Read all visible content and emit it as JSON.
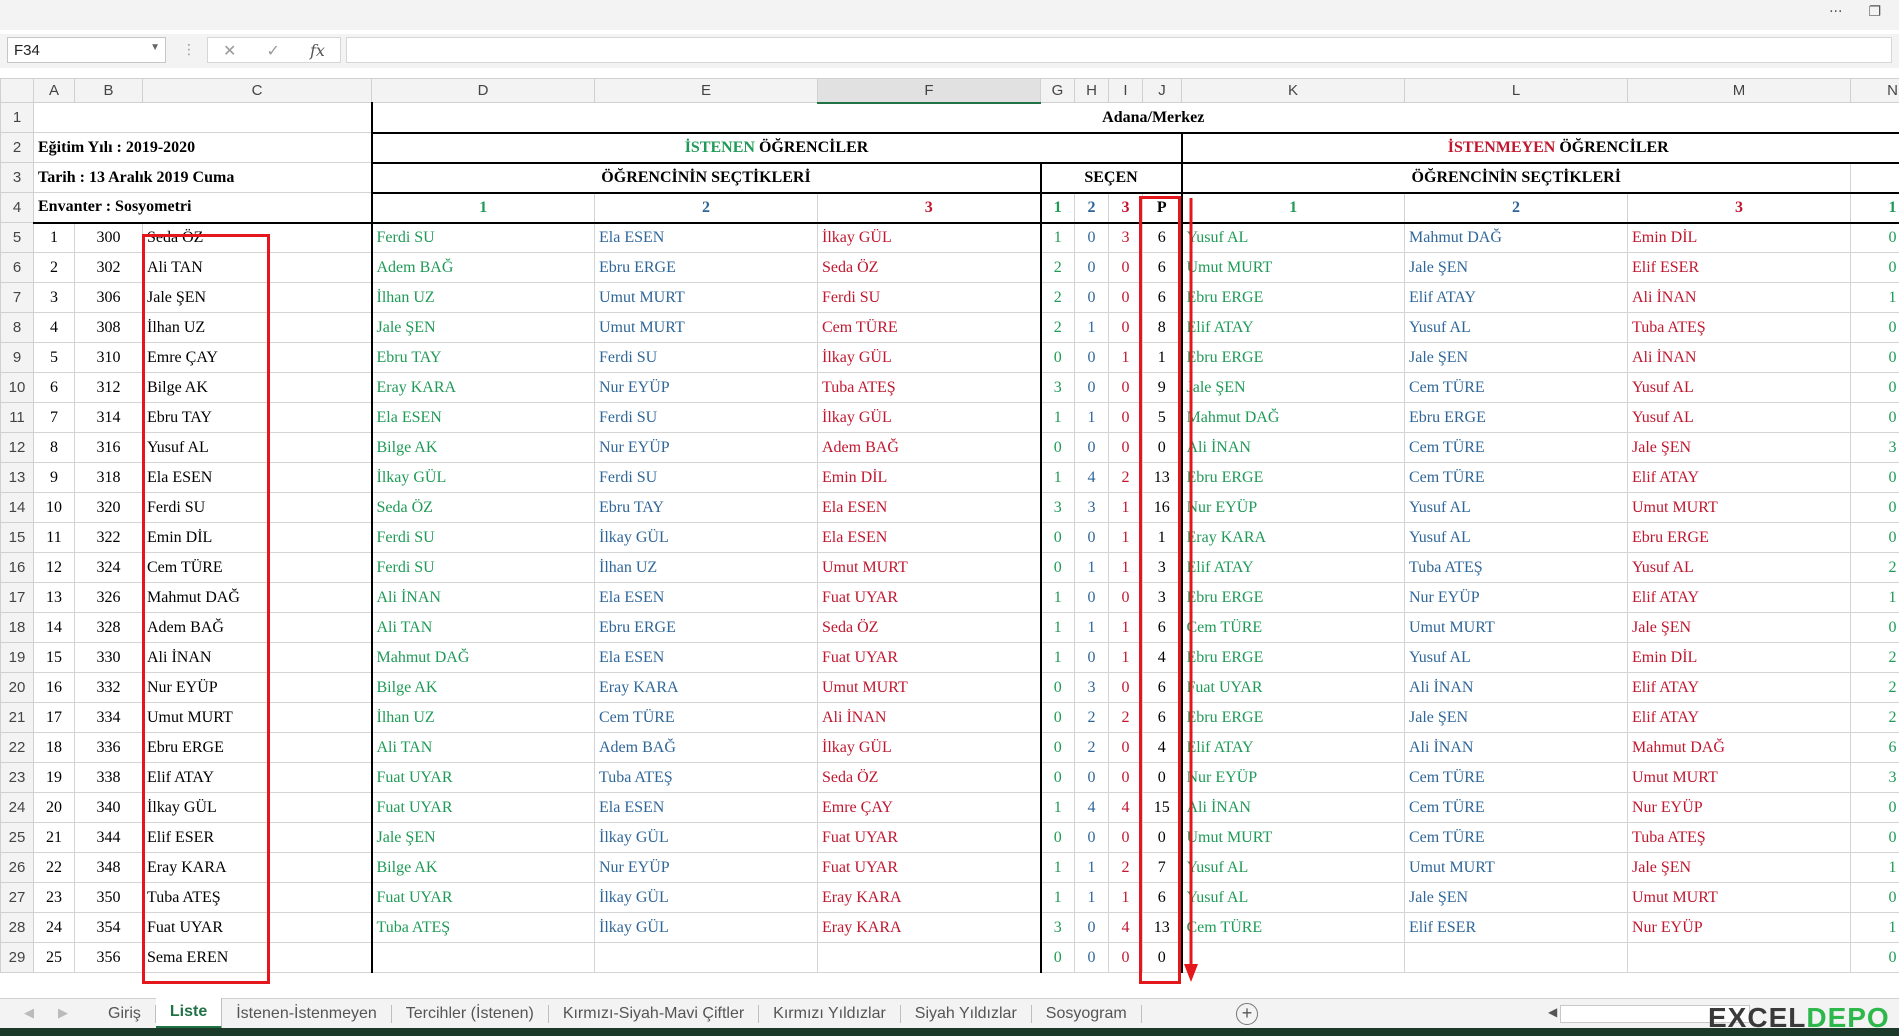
{
  "window": {
    "more_glyph": "···",
    "restore_glyph": "❐"
  },
  "formula_bar": {
    "cell_ref": "F34",
    "cancel": "✕",
    "enter": "✓",
    "fx": "fx",
    "value": ""
  },
  "columns": [
    "A",
    "B",
    "C",
    "D",
    "E",
    "F",
    "G",
    "H",
    "I",
    "J",
    "K",
    "L",
    "M",
    "N"
  ],
  "rows": [
    "1",
    "2",
    "3",
    "4",
    "5",
    "6",
    "7",
    "8",
    "9",
    "10",
    "11",
    "12",
    "13",
    "14",
    "15",
    "16",
    "17",
    "18",
    "19",
    "20",
    "21",
    "22",
    "23",
    "24",
    "25",
    "26",
    "27",
    "28",
    "29"
  ],
  "header": {
    "title": "Adana/Merkez",
    "egitim_yili": "Eğitim Yılı : 2019-2020",
    "tarih": "Tarih : 13 Aralık 2019 Cuma",
    "envanter": "Envanter : Sosyometri",
    "istenen_word": "İSTENEN",
    "istenmeyen_word": "İSTENMEYEN",
    "ogrenciler_word": "ÖĞRENCİLER",
    "ogrencinin_sectikleri": "ÖĞRENCİNİN SEÇTİKLERİ",
    "secen": "SEÇEN",
    "choice_nums": [
      "1",
      "2",
      "3"
    ],
    "p_label": "P",
    "n_partial": "1"
  },
  "students": [
    {
      "no": "1",
      "id": "300",
      "name": "Seda ÖZ",
      "w": [
        "Ferdi SU",
        "Ela ESEN",
        "İlkay GÜL"
      ],
      "s": [
        "1",
        "0",
        "3"
      ],
      "p": "6",
      "u": [
        "Yusuf AL",
        "Mahmut DAĞ",
        "Emin DİL"
      ],
      "n": "0"
    },
    {
      "no": "2",
      "id": "302",
      "name": "Ali TAN",
      "w": [
        "Adem BAĞ",
        "Ebru ERGE",
        "Seda ÖZ"
      ],
      "s": [
        "2",
        "0",
        "0"
      ],
      "p": "6",
      "u": [
        "Umut MURT",
        "Jale ŞEN",
        "Elif ESER"
      ],
      "n": "0"
    },
    {
      "no": "3",
      "id": "306",
      "name": "Jale ŞEN",
      "w": [
        "İlhan UZ",
        "Umut MURT",
        "Ferdi SU"
      ],
      "s": [
        "2",
        "0",
        "0"
      ],
      "p": "6",
      "u": [
        "Ebru ERGE",
        "Elif ATAY",
        "Ali İNAN"
      ],
      "n": "1"
    },
    {
      "no": "4",
      "id": "308",
      "name": "İlhan UZ",
      "w": [
        "Jale ŞEN",
        "Umut MURT",
        "Cem TÜRE"
      ],
      "s": [
        "2",
        "1",
        "0"
      ],
      "p": "8",
      "u": [
        "Elif ATAY",
        "Yusuf AL",
        "Tuba ATEŞ"
      ],
      "n": "0"
    },
    {
      "no": "5",
      "id": "310",
      "name": "Emre ÇAY",
      "w": [
        "Ebru TAY",
        "Ferdi SU",
        "İlkay GÜL"
      ],
      "s": [
        "0",
        "0",
        "1"
      ],
      "p": "1",
      "u": [
        "Ebru ERGE",
        "Jale ŞEN",
        "Ali İNAN"
      ],
      "n": "0"
    },
    {
      "no": "6",
      "id": "312",
      "name": "Bilge AK",
      "w": [
        "Eray KARA",
        "Nur EYÜP",
        "Tuba ATEŞ"
      ],
      "s": [
        "3",
        "0",
        "0"
      ],
      "p": "9",
      "u": [
        "Jale ŞEN",
        "Cem TÜRE",
        "Yusuf AL"
      ],
      "n": "0"
    },
    {
      "no": "7",
      "id": "314",
      "name": "Ebru TAY",
      "w": [
        "Ela ESEN",
        "Ferdi SU",
        "İlkay GÜL"
      ],
      "s": [
        "1",
        "1",
        "0"
      ],
      "p": "5",
      "u": [
        "Mahmut DAĞ",
        "Ebru ERGE",
        "Yusuf AL"
      ],
      "n": "0"
    },
    {
      "no": "8",
      "id": "316",
      "name": "Yusuf AL",
      "w": [
        "Bilge AK",
        "Nur EYÜP",
        "Adem BAĞ"
      ],
      "s": [
        "0",
        "0",
        "0"
      ],
      "p": "0",
      "u": [
        "Ali İNAN",
        "Cem TÜRE",
        "Jale ŞEN"
      ],
      "n": "3"
    },
    {
      "no": "9",
      "id": "318",
      "name": "Ela ESEN",
      "w": [
        "İlkay GÜL",
        "Ferdi SU",
        "Emin DİL"
      ],
      "s": [
        "1",
        "4",
        "2"
      ],
      "p": "13",
      "u": [
        "Ebru ERGE",
        "Cem TÜRE",
        "Elif ATAY"
      ],
      "n": "0"
    },
    {
      "no": "10",
      "id": "320",
      "name": "Ferdi SU",
      "w": [
        "Seda ÖZ",
        "Ebru TAY",
        "Ela ESEN"
      ],
      "s": [
        "3",
        "3",
        "1"
      ],
      "p": "16",
      "u": [
        "Nur EYÜP",
        "Yusuf AL",
        "Umut MURT"
      ],
      "n": "0"
    },
    {
      "no": "11",
      "id": "322",
      "name": "Emin DİL",
      "w": [
        "Ferdi SU",
        "İlkay GÜL",
        "Ela ESEN"
      ],
      "s": [
        "0",
        "0",
        "1"
      ],
      "p": "1",
      "u": [
        "Eray KARA",
        "Yusuf AL",
        "Ebru ERGE"
      ],
      "n": "0"
    },
    {
      "no": "12",
      "id": "324",
      "name": "Cem TÜRE",
      "w": [
        "Ferdi SU",
        "İlhan UZ",
        "Umut MURT"
      ],
      "s": [
        "0",
        "1",
        "1"
      ],
      "p": "3",
      "u": [
        "Elif ATAY",
        "Tuba ATEŞ",
        "Yusuf AL"
      ],
      "n": "2"
    },
    {
      "no": "13",
      "id": "326",
      "name": "Mahmut DAĞ",
      "w": [
        "Ali İNAN",
        "Ela ESEN",
        "Fuat UYAR"
      ],
      "s": [
        "1",
        "0",
        "0"
      ],
      "p": "3",
      "u": [
        "Ebru ERGE",
        "Nur EYÜP",
        "Elif ATAY"
      ],
      "n": "1"
    },
    {
      "no": "14",
      "id": "328",
      "name": "Adem BAĞ",
      "w": [
        "Ali TAN",
        "Ebru ERGE",
        "Seda ÖZ"
      ],
      "s": [
        "1",
        "1",
        "1"
      ],
      "p": "6",
      "u": [
        "Cem TÜRE",
        "Umut MURT",
        "Jale ŞEN"
      ],
      "n": "0"
    },
    {
      "no": "15",
      "id": "330",
      "name": "Ali İNAN",
      "w": [
        "Mahmut DAĞ",
        "Ela ESEN",
        "Fuat UYAR"
      ],
      "s": [
        "1",
        "0",
        "1"
      ],
      "p": "4",
      "u": [
        "Ebru ERGE",
        "Yusuf AL",
        "Emin DİL"
      ],
      "n": "2"
    },
    {
      "no": "16",
      "id": "332",
      "name": "Nur EYÜP",
      "w": [
        "Bilge AK",
        "Eray KARA",
        "Umut MURT"
      ],
      "s": [
        "0",
        "3",
        "0"
      ],
      "p": "6",
      "u": [
        "Fuat UYAR",
        "Ali İNAN",
        "Elif ATAY"
      ],
      "n": "2"
    },
    {
      "no": "17",
      "id": "334",
      "name": "Umut MURT",
      "w": [
        "İlhan UZ",
        "Cem TÜRE",
        "Ali İNAN"
      ],
      "s": [
        "0",
        "2",
        "2"
      ],
      "p": "6",
      "u": [
        "Ebru ERGE",
        "Jale ŞEN",
        "Elif ATAY"
      ],
      "n": "2"
    },
    {
      "no": "18",
      "id": "336",
      "name": "Ebru ERGE",
      "w": [
        "Ali TAN",
        "Adem BAĞ",
        "İlkay GÜL"
      ],
      "s": [
        "0",
        "2",
        "0"
      ],
      "p": "4",
      "u": [
        "Elif ATAY",
        "Ali İNAN",
        "Mahmut DAĞ"
      ],
      "n": "6"
    },
    {
      "no": "19",
      "id": "338",
      "name": "Elif ATAY",
      "w": [
        "Fuat UYAR",
        "Tuba ATEŞ",
        "Seda ÖZ"
      ],
      "s": [
        "0",
        "0",
        "0"
      ],
      "p": "0",
      "u": [
        "Nur EYÜP",
        "Cem TÜRE",
        "Umut MURT"
      ],
      "n": "3"
    },
    {
      "no": "20",
      "id": "340",
      "name": "İlkay GÜL",
      "w": [
        "Fuat UYAR",
        "Ela ESEN",
        "Emre ÇAY"
      ],
      "s": [
        "1",
        "4",
        "4"
      ],
      "p": "15",
      "u": [
        "Ali İNAN",
        "Cem TÜRE",
        "Nur EYÜP"
      ],
      "n": "0"
    },
    {
      "no": "21",
      "id": "344",
      "name": "Elif ESER",
      "w": [
        "Jale ŞEN",
        "İlkay GÜL",
        "Fuat UYAR"
      ],
      "s": [
        "0",
        "0",
        "0"
      ],
      "p": "0",
      "u": [
        "Umut MURT",
        "Cem TÜRE",
        "Tuba ATEŞ"
      ],
      "n": "0"
    },
    {
      "no": "22",
      "id": "348",
      "name": "Eray KARA",
      "w": [
        "Bilge AK",
        "Nur EYÜP",
        "Fuat UYAR"
      ],
      "s": [
        "1",
        "1",
        "2"
      ],
      "p": "7",
      "u": [
        "Yusuf AL",
        "Umut MURT",
        "Jale ŞEN"
      ],
      "n": "1"
    },
    {
      "no": "23",
      "id": "350",
      "name": "Tuba ATEŞ",
      "w": [
        "Fuat UYAR",
        "İlkay GÜL",
        "Eray KARA"
      ],
      "s": [
        "1",
        "1",
        "1"
      ],
      "p": "6",
      "u": [
        "Yusuf AL",
        "Jale ŞEN",
        "Umut MURT"
      ],
      "n": "0"
    },
    {
      "no": "24",
      "id": "354",
      "name": "Fuat UYAR",
      "w": [
        "Tuba ATEŞ",
        "İlkay GÜL",
        "Eray KARA"
      ],
      "s": [
        "3",
        "0",
        "4"
      ],
      "p": "13",
      "u": [
        "Cem TÜRE",
        "Elif ESER",
        "Nur EYÜP"
      ],
      "n": "1"
    },
    {
      "no": "25",
      "id": "356",
      "name": "Sema EREN",
      "w": [
        "",
        "",
        ""
      ],
      "s": [
        "0",
        "0",
        "0"
      ],
      "p": "0",
      "u": [
        "",
        "",
        ""
      ],
      "n": "0"
    }
  ],
  "tabs": [
    "Giriş",
    "Liste",
    "İstenen-İstenmeyen",
    "Tercihler (İstenen)",
    "Kırmızı-Siyah-Mavi Çiftler",
    "Kırmızı Yıldızlar",
    "Siyah Yıldızlar",
    "Sosyogram"
  ],
  "active_tab": "Liste",
  "tab_nav": [
    "◀",
    "▶"
  ],
  "add_sheet": "+",
  "logo": {
    "part1": "EXCEL",
    "part2": "DEPO"
  },
  "colors": {
    "green": "#1f9a57",
    "blue": "#2f6698",
    "red": "#c0172f",
    "accent": "#217346",
    "highlight": "#e3171c"
  }
}
